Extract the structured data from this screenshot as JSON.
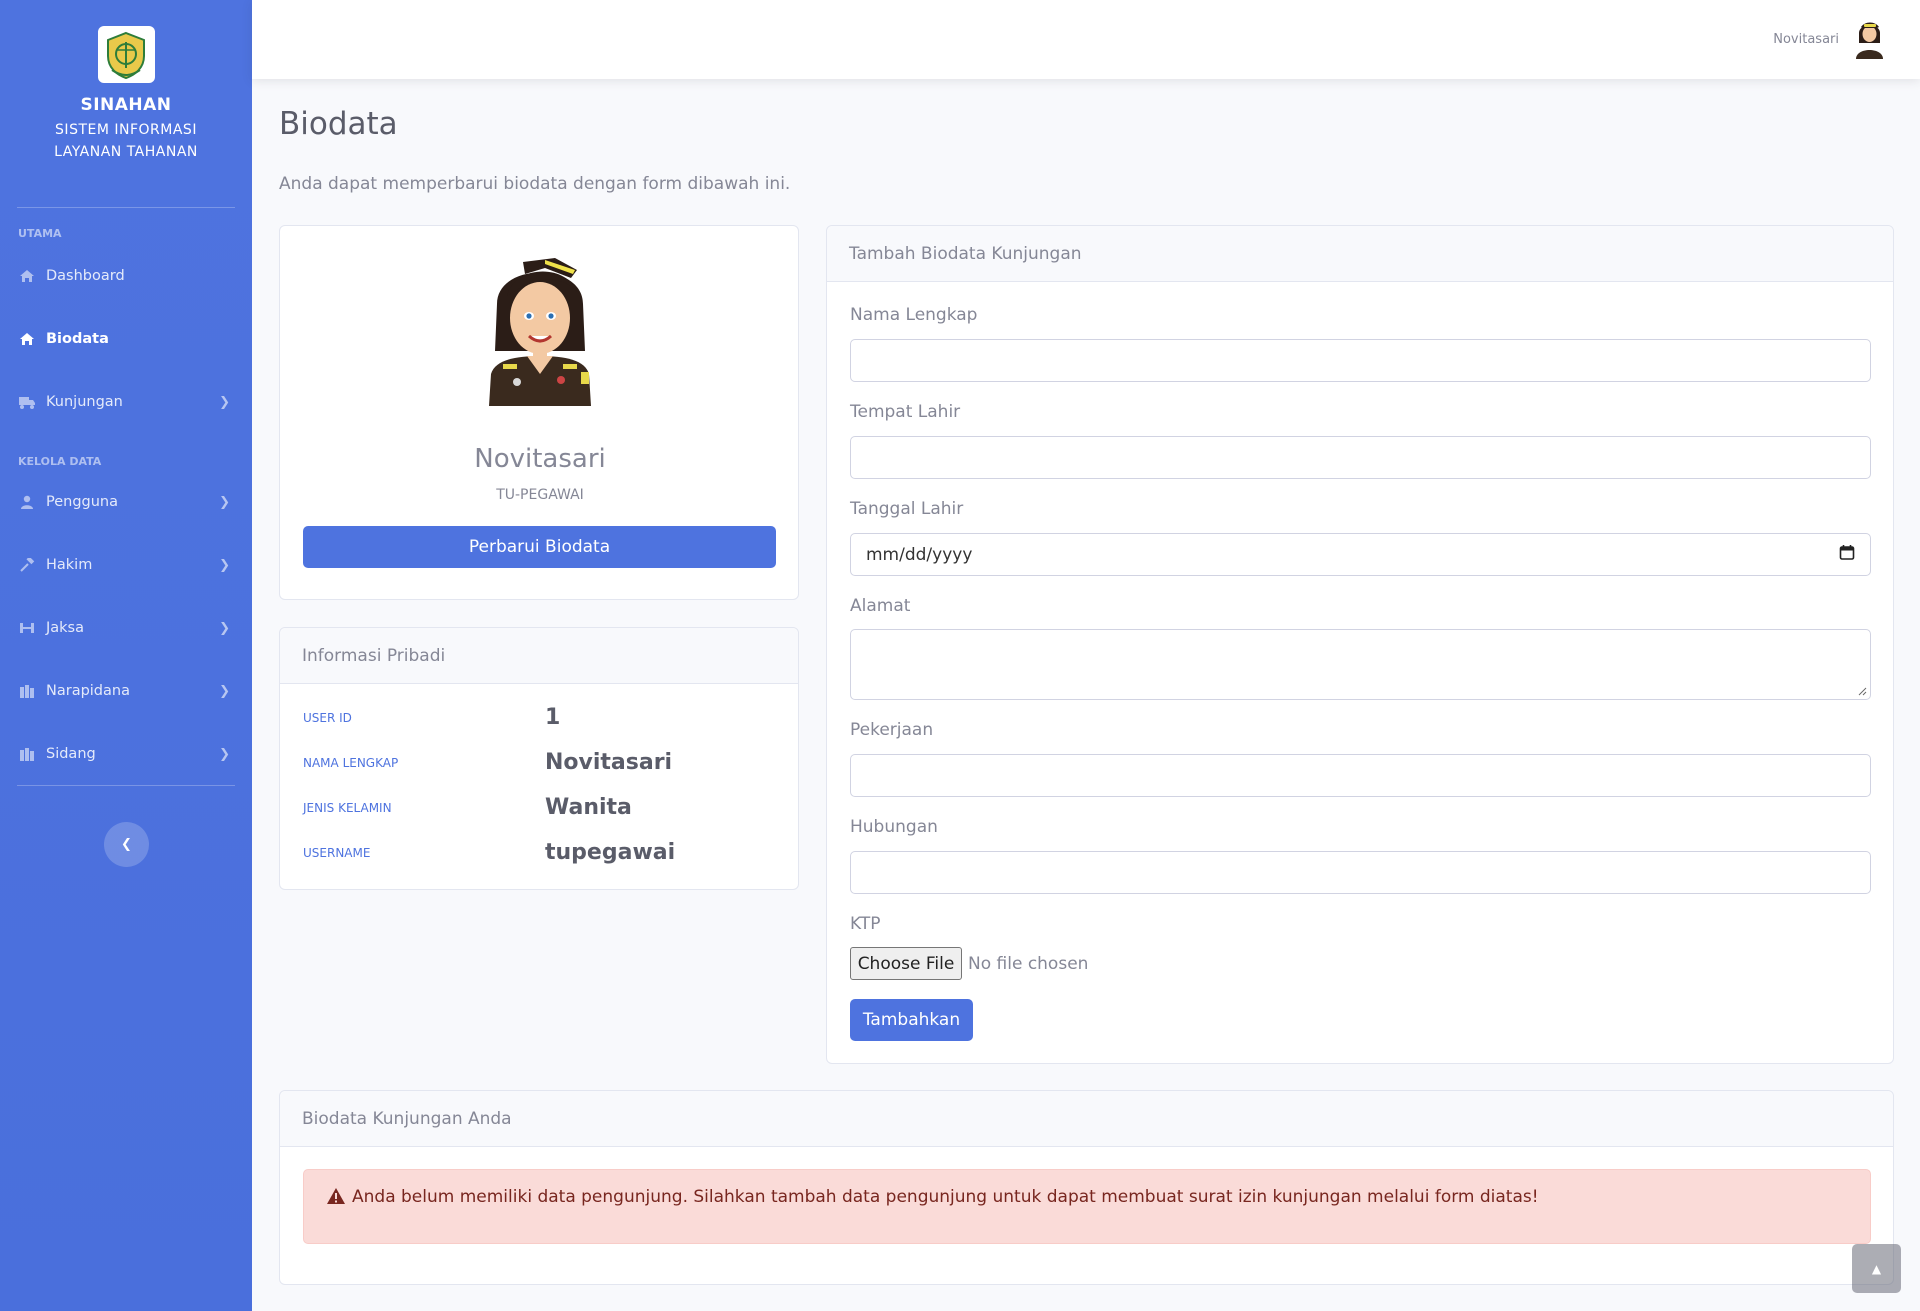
{
  "brand": {
    "title": "SINAHAN",
    "subtitle_line1": "SISTEM INFORMASI",
    "subtitle_line2": "LAYANAN TAHANAN"
  },
  "sidebar": {
    "heading_main": "UTAMA",
    "heading_data": "KELOLA DATA",
    "items": [
      {
        "label": "Dashboard",
        "icon": "home-icon",
        "active": false,
        "has_submenu": false
      },
      {
        "label": "Biodata",
        "icon": "home-icon",
        "active": true,
        "has_submenu": false
      },
      {
        "label": "Kunjungan",
        "icon": "truck-icon",
        "active": false,
        "has_submenu": true
      },
      {
        "label": "Pengguna",
        "icon": "user-icon",
        "active": false,
        "has_submenu": true
      },
      {
        "label": "Hakim",
        "icon": "gavel-icon",
        "active": false,
        "has_submenu": true
      },
      {
        "label": "Jaksa",
        "icon": "people-icon",
        "active": false,
        "has_submenu": true
      },
      {
        "label": "Narapidana",
        "icon": "building-icon",
        "active": false,
        "has_submenu": true
      },
      {
        "label": "Sidang",
        "icon": "building-icon",
        "active": false,
        "has_submenu": true
      }
    ]
  },
  "topbar": {
    "username": "Novitasari"
  },
  "page": {
    "title": "Biodata",
    "description": "Anda dapat memperbarui biodata dengan form dibawah ini."
  },
  "profile": {
    "name": "Novitasari",
    "role": "TU-PEGAWAI",
    "update_button": "Perbarui Biodata"
  },
  "info": {
    "header": "Informasi Pribadi",
    "rows": [
      {
        "label": "USER ID",
        "value": "1"
      },
      {
        "label": "NAMA LENGKAP",
        "value": "Novitasari"
      },
      {
        "label": "JENIS KELAMIN",
        "value": "Wanita"
      },
      {
        "label": "USERNAME",
        "value": "tupegawai"
      }
    ]
  },
  "form": {
    "header": "Tambah Biodata Kunjungan",
    "nama_label": "Nama Lengkap",
    "tempat_label": "Tempat Lahir",
    "tanggal_label": "Tanggal Lahir",
    "tanggal_placeholder": "mm/dd/yyyy",
    "alamat_label": "Alamat",
    "pekerjaan_label": "Pekerjaan",
    "hubungan_label": "Hubungan",
    "ktp_label": "KTP",
    "file_button": "Choose File",
    "file_status": "No file chosen",
    "submit": "Tambahkan"
  },
  "visits": {
    "header": "Biodata Kunjungan Anda",
    "alert": "Anda belum memiliki data pengunjung. Silahkan tambah data pengunjung untuk dapat membuat surat izin kunjungan melalui form diatas!"
  },
  "colors": {
    "primary": "#4e73df",
    "alert_bg": "#fadbd8",
    "alert_text": "#78261f"
  }
}
